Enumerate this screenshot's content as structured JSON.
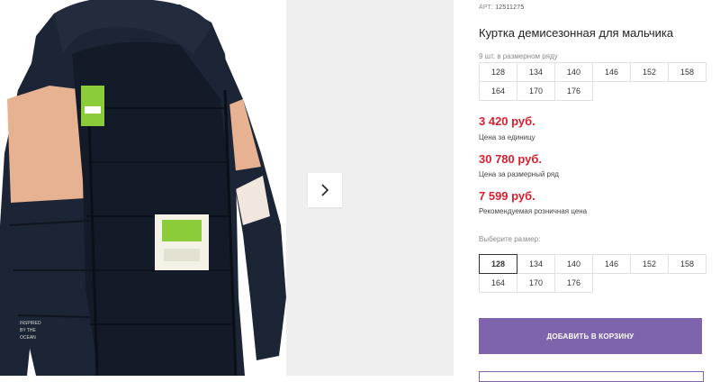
{
  "product": {
    "art_label": "АРТ:",
    "art_value": "12511275",
    "title": "Куртка демисезонная для мальчика",
    "qty_in_row": "9 шт. в размерном ряду",
    "row_sizes": [
      "128",
      "134",
      "140",
      "146",
      "152",
      "158",
      "164",
      "170",
      "176"
    ],
    "prices": [
      {
        "value": "3 420 руб.",
        "label": "Цена за единицу"
      },
      {
        "value": "30 780 руб.",
        "label": "Цена за размерный ряд"
      },
      {
        "value": "7 599 руб.",
        "label": "Рекомендуемая розничная цена"
      }
    ],
    "choose_label": "Выберите размер:",
    "choose_sizes": [
      "128",
      "134",
      "140",
      "146",
      "152",
      "158",
      "164",
      "170",
      "176"
    ],
    "selected_size": "128",
    "add_to_cart": "ДОБАВИТЬ В КОРЗИНУ"
  },
  "photo": {
    "tag_brand": "Button Blue",
    "chest_print": "INSPIRED BY THE OCEAN"
  },
  "colors": {
    "price": "#d4212f",
    "cart_button": "#7e63ad",
    "jacket_navy": "#1c2535",
    "jacket_peach": "#e6b292",
    "tag_green": "#8ccc3a"
  },
  "icons": {
    "next": "chevron-right-icon"
  }
}
